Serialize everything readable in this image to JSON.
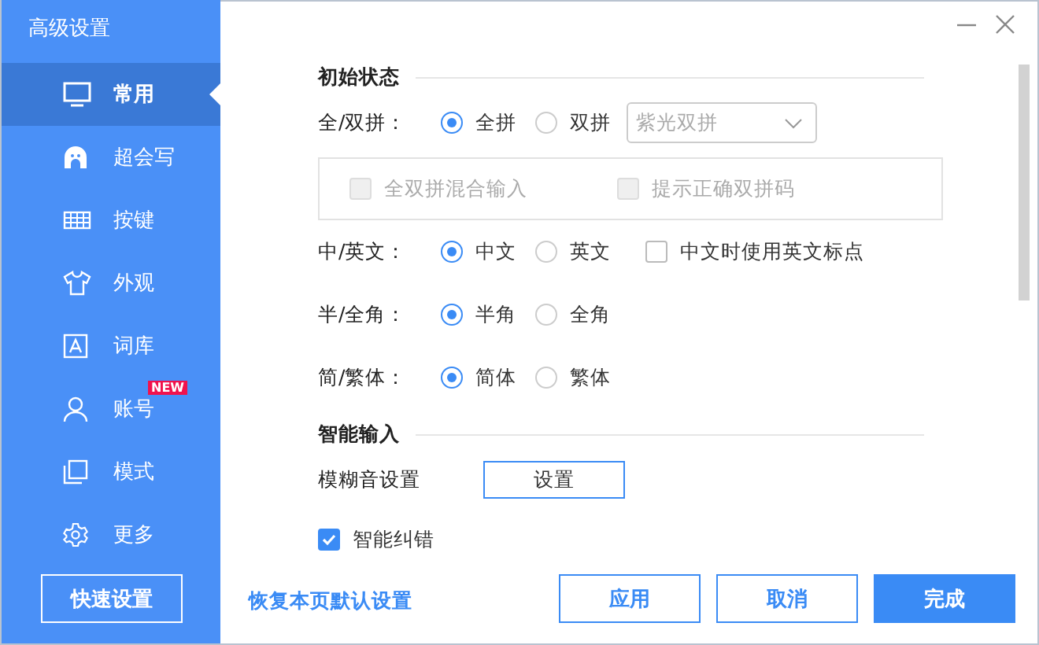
{
  "window": {
    "title": "高级设置"
  },
  "sidebar": {
    "items": [
      {
        "label": "常用",
        "selected": true
      },
      {
        "label": "超会写",
        "selected": false
      },
      {
        "label": "按键",
        "selected": false
      },
      {
        "label": "外观",
        "selected": false
      },
      {
        "label": "词库",
        "selected": false
      },
      {
        "label": "账号",
        "selected": false,
        "badge": "NEW"
      },
      {
        "label": "模式",
        "selected": false
      },
      {
        "label": "更多",
        "selected": false
      }
    ],
    "quick_button": "快速设置"
  },
  "sections": [
    {
      "title": "初始状态",
      "rows": [
        {
          "kind": "radio",
          "label": "全/双拼：",
          "options": [
            {
              "label": "全拼",
              "selected": true
            },
            {
              "label": "双拼",
              "selected": false
            }
          ],
          "dropdown": {
            "value": "紫光双拼",
            "disabled": true
          },
          "sub_options": [
            {
              "label": "全双拼混合输入",
              "checked": false,
              "disabled": true
            },
            {
              "label": "提示正确双拼码",
              "checked": false,
              "disabled": true
            }
          ]
        },
        {
          "kind": "radio",
          "label": "中/英文：",
          "options": [
            {
              "label": "中文",
              "selected": true
            },
            {
              "label": "英文",
              "selected": false
            }
          ],
          "checkbox": {
            "label": "中文时使用英文标点",
            "checked": false
          }
        },
        {
          "kind": "radio",
          "label": "半/全角：",
          "options": [
            {
              "label": "半角",
              "selected": true
            },
            {
              "label": "全角",
              "selected": false
            }
          ]
        },
        {
          "kind": "radio",
          "label": "简/繁体：",
          "options": [
            {
              "label": "简体",
              "selected": true
            },
            {
              "label": "繁体",
              "selected": false
            }
          ]
        }
      ]
    },
    {
      "title": "智能输入",
      "rows": [
        {
          "kind": "button",
          "label": "模糊音设置",
          "button": "设置"
        },
        {
          "kind": "checkbox",
          "label": "智能纠错",
          "checked": true
        }
      ]
    }
  ],
  "footer": {
    "reset_link": "恢复本页默认设置",
    "buttons": [
      {
        "label": "应用",
        "primary": false
      },
      {
        "label": "取消",
        "primary": false
      },
      {
        "label": "完成",
        "primary": true
      }
    ]
  }
}
